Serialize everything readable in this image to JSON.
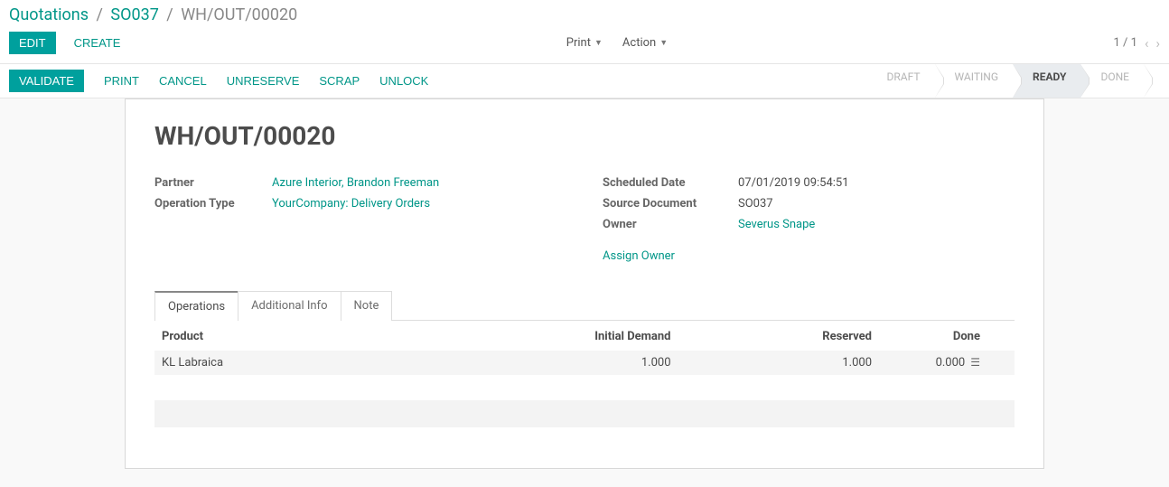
{
  "breadcrumb": {
    "root": "Quotations",
    "parent": "SO037",
    "current": "WH/OUT/00020"
  },
  "buttons": {
    "edit": "EDIT",
    "create": "CREATE",
    "print": "Print",
    "action": "Action",
    "validate": "VALIDATE",
    "print2": "PRINT",
    "cancel": "CANCEL",
    "unreserve": "UNRESERVE",
    "scrap": "SCRAP",
    "unlock": "UNLOCK"
  },
  "pager": {
    "text": "1 / 1"
  },
  "status": {
    "draft": "DRAFT",
    "waiting": "WAITING",
    "ready": "READY",
    "done": "DONE"
  },
  "sheet": {
    "title": "WH/OUT/00020",
    "partner_label": "Partner",
    "partner_value": "Azure Interior, Brandon Freeman",
    "optype_label": "Operation Type",
    "optype_value": "YourCompany: Delivery Orders",
    "sched_label": "Scheduled Date",
    "sched_value": "07/01/2019 09:54:51",
    "source_label": "Source Document",
    "source_value": "SO037",
    "owner_label": "Owner",
    "owner_value": "Severus Snape",
    "assign_owner": "Assign Owner"
  },
  "tabs": {
    "operations": "Operations",
    "additional": "Additional Info",
    "note": "Note"
  },
  "table": {
    "headers": {
      "product": "Product",
      "initial": "Initial Demand",
      "reserved": "Reserved",
      "done": "Done"
    },
    "rows": [
      {
        "product": "KL Labraica",
        "initial": "1.000",
        "reserved": "1.000",
        "done": "0.000"
      }
    ]
  }
}
